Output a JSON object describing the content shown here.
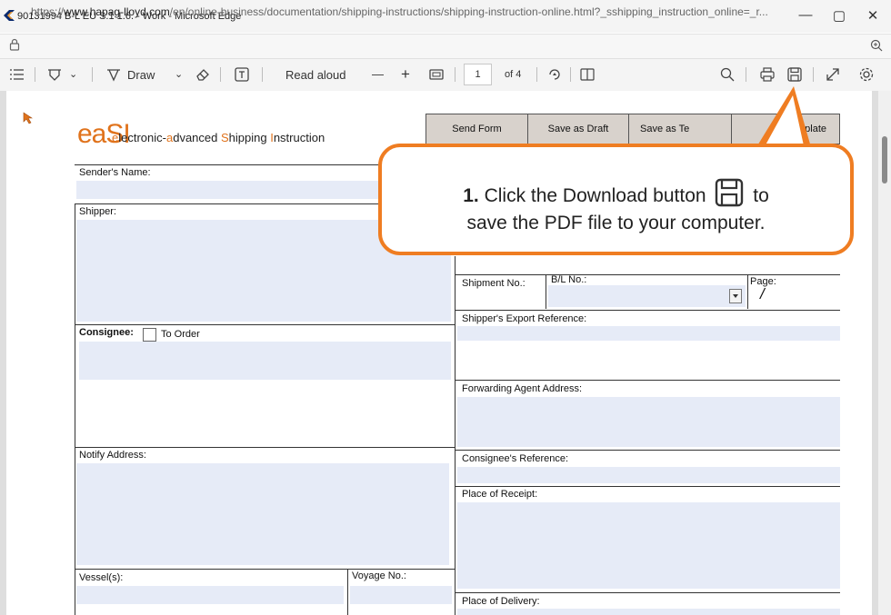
{
  "window": {
    "title": "90131994 B-L EU S.1 1.6. - Work - Microsoft Edge",
    "url_prefix": "https://",
    "url_domain": "www.hapag-lloyd.com",
    "url_path": "/en/online-business/documentation/shipping-instructions/shipping-instruction-online.html?_sshipping_instruction_online=_r...",
    "controls": {
      "minimize": "—",
      "maximize": "▢",
      "close": "✕"
    }
  },
  "toolbar": {
    "draw_label": "Draw",
    "read_aloud_label": "Read aloud",
    "zoom_out": "—",
    "zoom_in": "+",
    "page_number": "1",
    "page_total": "of 4"
  },
  "form": {
    "logo_main": "eaSI",
    "logo_sub": {
      "a": "e",
      "b": "lectronic-",
      "c": "a",
      "d": "dvanced ",
      "e": "S",
      "f": "hipping ",
      "g": "I",
      "h": "nstruction"
    },
    "buttons": {
      "send": "Send Form",
      "draft": "Save as Draft",
      "template": "Save as Te",
      "template2": "Template"
    },
    "labels": {
      "sender": "Sender's Name:",
      "shipper": "Shipper:",
      "consignee": "Consignee:",
      "to_order": "To Order",
      "notify": "Notify Address:",
      "vessel": "Vessel(s):",
      "voyage": "Voyage No.:",
      "shipment_no": "Shipment No.:",
      "bl_no": "B/L No.:",
      "page": "Page:",
      "page_slash": "/",
      "export_ref": "Shipper's Export Reference:",
      "forwarding": "Forwarding Agent Address:",
      "consignee_ref": "Consignee's Reference:",
      "receipt": "Place of Receipt:",
      "delivery": "Place of Delivery:"
    }
  },
  "callout": {
    "step": "1.",
    "text_a": "Click the Download button",
    "text_b": "to",
    "text_c": "save the PDF file to your computer.",
    "color": "#ef7d22"
  }
}
